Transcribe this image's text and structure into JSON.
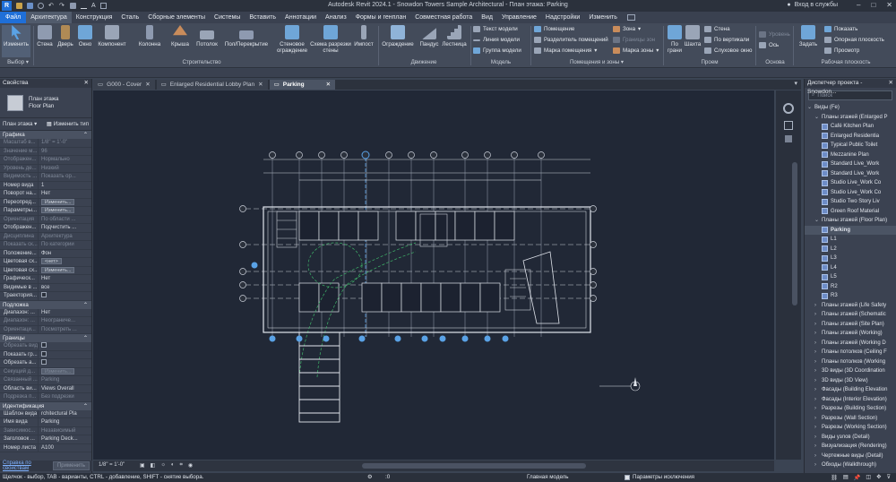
{
  "app": {
    "title": "Autodesk Revit 2024.1 - Snowdon Towers Sample Architectural - План этажа: Parking",
    "login": "Вход в службы",
    "logo": "R"
  },
  "menu": [
    "Файл",
    "Архитектура",
    "Конструкция",
    "Сталь",
    "Сборные элементы",
    "Системы",
    "Вставить",
    "Аннотации",
    "Анализ",
    "Формы и генплан",
    "Совместная работа",
    "Вид",
    "Управление",
    "Надстройки",
    "Изменить"
  ],
  "ribbon": {
    "tools": [
      {
        "id": "modify",
        "label": "Изменить",
        "color": "#5aa2e6"
      },
      {
        "id": "wall",
        "label": "Стена",
        "color": "#8f9bb0"
      },
      {
        "id": "door",
        "label": "Дверь",
        "color": "#b08a55"
      },
      {
        "id": "window",
        "label": "Окно",
        "color": "#6fa6d8"
      },
      {
        "id": "component",
        "label": "Компонент",
        "color": "#9aa5b7"
      },
      {
        "id": "column",
        "label": "Колонна",
        "color": "#8e9ab0"
      },
      {
        "id": "roof",
        "label": "Крыша",
        "color": "#c98c5b"
      },
      {
        "id": "ceiling",
        "label": "Потолок",
        "color": "#9aa5b7"
      },
      {
        "id": "floor",
        "label": "Пол/Перекрытие",
        "color": "#8e9ab0"
      },
      {
        "id": "curtain",
        "label": "Стеновое ограждение",
        "color": "#6fa6d8"
      },
      {
        "id": "curtainsys",
        "label": "Схема разрезки стены",
        "color": "#6fa6d8"
      },
      {
        "id": "mullion",
        "label": "Импост",
        "color": "#9aa5b7"
      },
      {
        "id": "railing",
        "label": "Ограждение",
        "color": "#8fb3d8"
      },
      {
        "id": "ramp",
        "label": "Пандус",
        "color": "#9aa5b7"
      },
      {
        "id": "stair",
        "label": "Лестница",
        "color": "#9aa5b7"
      },
      {
        "id": "byface",
        "label": "По грани",
        "color": "#6fa6d8"
      },
      {
        "id": "shaft",
        "label": "Шахта",
        "color": "#9aa5b7"
      },
      {
        "id": "set",
        "label": "Задать",
        "color": "#6fa6d8"
      }
    ],
    "small": {
      "model_text": "Текст модели",
      "model_line": "Линия модели",
      "model_group": "Группа модели",
      "room": "Помещение",
      "room_sep": "Разделитель помещений",
      "room_tag": "Марка помещения",
      "area": "Зона",
      "area_bound": "Границы зон",
      "area_tag": "Марка зоны",
      "wall_open": "Стена",
      "vertical": "По вертикали",
      "dormer": "Слуховое окно",
      "level": "Уровень",
      "grid": "Ось",
      "show": "Показать",
      "ref_plane": "Опорная плоскость",
      "viewer": "Просмотр"
    },
    "groups": {
      "select": "Выбор",
      "build": "Строительство",
      "circulation": "Движение",
      "model": "Модель",
      "room_area": "Помещения и зоны",
      "opening": "Проем",
      "datum": "Основа",
      "workplane": "Рабочая плоскость"
    }
  },
  "properties": {
    "title": "Свойства",
    "type_name": "План этажа",
    "type_sub": "Floor Plan",
    "selector": "План этажа",
    "edit_type": "Изменить тип",
    "sections": {
      "graphics": "Графика",
      "underlay": "Подложка",
      "extents": "Границы",
      "identity": "Идентификация"
    },
    "graphics_rows": [
      {
        "k": "Масштаб в...",
        "v": "1/8\" = 1'-0\"",
        "dim": true
      },
      {
        "k": "Значение м...",
        "v": "96",
        "dim": true
      },
      {
        "k": "Отображен...",
        "v": "Нормально",
        "dim": true
      },
      {
        "k": "Уровень де...",
        "v": "Низкий",
        "dim": true
      },
      {
        "k": "Видимость ...",
        "v": "Показать ор...",
        "dim": true
      },
      {
        "k": "Номер вида",
        "v": "1"
      },
      {
        "k": "Поворот на...",
        "v": "Нет"
      },
      {
        "k": "Переопред...",
        "v": "Изменить...",
        "btn": true
      },
      {
        "k": "Параметры...",
        "v": "Изменить...",
        "btn": true
      },
      {
        "k": "Ориентация",
        "v": "По области ...",
        "dim": true
      },
      {
        "k": "Отображен...",
        "v": "Подчистить ..."
      },
      {
        "k": "Дисциплина",
        "v": "Архитектура",
        "dim": true
      },
      {
        "k": "Показать ск...",
        "v": "По категории",
        "dim": true
      },
      {
        "k": "Положение...",
        "v": "Фон"
      },
      {
        "k": "Цветовая сх...",
        "v": "<нет>",
        "btn": true
      },
      {
        "k": "Цветовая сх...",
        "v": "Изменить...",
        "btn": true
      },
      {
        "k": "Графическ...",
        "v": "Нет"
      },
      {
        "k": "Видимые в ...",
        "v": "все"
      },
      {
        "k": "Траектория...",
        "v": "",
        "cb": true
      }
    ],
    "underlay_rows": [
      {
        "k": "Диапазон: ...",
        "v": "Нет"
      },
      {
        "k": "Диапазон: ...",
        "v": "Неограниче...",
        "dim": true
      },
      {
        "k": "Ориентаци...",
        "v": "Посмотреть ...",
        "dim": true
      }
    ],
    "extents_rows": [
      {
        "k": "Обрезать вид",
        "v": "",
        "cb": true,
        "dim": true
      },
      {
        "k": "Показать гр...",
        "v": "",
        "cb": true
      },
      {
        "k": "Обрезать а...",
        "v": "",
        "cb": true
      },
      {
        "k": "Секущий д...",
        "v": "Изменить...",
        "btn": true,
        "dim": true
      },
      {
        "k": "Связанный ...",
        "v": "Parking",
        "dim": true
      },
      {
        "k": "Область ви...",
        "v": "Views Overall"
      },
      {
        "k": "Подрезка п...",
        "v": "Без подрезки",
        "dim": true
      }
    ],
    "identity_rows": [
      {
        "k": "Шаблон вида",
        "v": "rchitectural Pla"
      },
      {
        "k": "Имя вида",
        "v": "Parking"
      },
      {
        "k": "Зависимос...",
        "v": "Независимый",
        "dim": true
      },
      {
        "k": "Заголовок ...",
        "v": "Parking Deck..."
      },
      {
        "k": "Номер листа",
        "v": "A100"
      }
    ],
    "help": "Справка по свойствам",
    "apply": "Применить"
  },
  "tabs": [
    {
      "label": "G000 - Cover",
      "active": false
    },
    {
      "label": "Enlarged Residential Lobby Plan",
      "active": false
    },
    {
      "label": "Parking",
      "active": true
    }
  ],
  "browser": {
    "title": "Диспетчер проекта - Snowdon...",
    "search": "Поиск",
    "items": [
      {
        "t": "Виды (Fe)",
        "lvl": 0,
        "ex": "−"
      },
      {
        "t": "Планы этажей (Enlarged P",
        "lvl": 1,
        "ex": "−"
      },
      {
        "t": "Café Kitchen Plan",
        "lvl": 2
      },
      {
        "t": "Enlarged Residentia",
        "lvl": 2
      },
      {
        "t": "Typical Public Toilet",
        "lvl": 2
      },
      {
        "t": "Mezzanine Plan",
        "lvl": 2
      },
      {
        "t": "Standard Live_Work",
        "lvl": 2
      },
      {
        "t": "Standard Live_Work",
        "lvl": 2
      },
      {
        "t": "Studio Live_Work Co",
        "lvl": 2
      },
      {
        "t": "Studio Live_Work Co",
        "lvl": 2
      },
      {
        "t": "Studio Two Story Liv",
        "lvl": 2
      },
      {
        "t": "Green Roof Material",
        "lvl": 2
      },
      {
        "t": "Планы этажей (Floor Plan)",
        "lvl": 1,
        "ex": "−"
      },
      {
        "t": "Parking",
        "lvl": 2,
        "bold": true
      },
      {
        "t": "L1",
        "lvl": 2
      },
      {
        "t": "L2",
        "lvl": 2
      },
      {
        "t": "L3",
        "lvl": 2
      },
      {
        "t": "L4",
        "lvl": 2
      },
      {
        "t": "L5",
        "lvl": 2
      },
      {
        "t": "R2",
        "lvl": 2
      },
      {
        "t": "R3",
        "lvl": 2
      },
      {
        "t": "Планы этажей (Life Safety",
        "lvl": 1,
        "ex": "+"
      },
      {
        "t": "Планы этажей (Schematic",
        "lvl": 1,
        "ex": "+"
      },
      {
        "t": "Планы этажей (Site Plan)",
        "lvl": 1,
        "ex": "+"
      },
      {
        "t": "Планы этажей (Working)",
        "lvl": 1,
        "ex": "+"
      },
      {
        "t": "Планы этажей (Working D",
        "lvl": 1,
        "ex": "+"
      },
      {
        "t": "Планы потолков (Ceiling F",
        "lvl": 1,
        "ex": "+"
      },
      {
        "t": "Планы потолков (Working",
        "lvl": 1,
        "ex": "+"
      },
      {
        "t": "3D виды (3D Coordination",
        "lvl": 1,
        "ex": "+"
      },
      {
        "t": "3D виды (3D View)",
        "lvl": 1,
        "ex": "+"
      },
      {
        "t": "Фасады (Building Elevation",
        "lvl": 1,
        "ex": "+"
      },
      {
        "t": "Фасады (Interior Elevation)",
        "lvl": 1,
        "ex": "+"
      },
      {
        "t": "Разрезы (Building Section)",
        "lvl": 1,
        "ex": "+"
      },
      {
        "t": "Разрезы (Wall Section)",
        "lvl": 1,
        "ex": "+"
      },
      {
        "t": "Разрезы (Working Section)",
        "lvl": 1,
        "ex": "+"
      },
      {
        "t": "Виды узлов (Detail)",
        "lvl": 1,
        "ex": "+"
      },
      {
        "t": "Визуализация (Rendering)",
        "lvl": 1,
        "ex": "+"
      },
      {
        "t": "Чертежные виды (Detail)",
        "lvl": 1,
        "ex": "+"
      },
      {
        "t": "Обходы (Walkthrough)",
        "lvl": 1,
        "ex": "+"
      }
    ]
  },
  "viewcontrol": {
    "scale": "1/8\" = 1'-0\""
  },
  "status": {
    "hint": "Щелчок - выбор, TAB - варианты, CTRL - добавление, SHIFT - снятие выбора.",
    "model": "Главная модель",
    "exclusions": "Параметры исключения",
    "zero": ":0"
  }
}
